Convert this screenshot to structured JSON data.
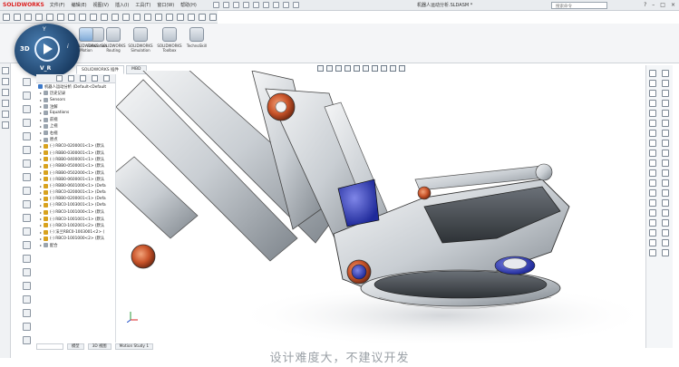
{
  "app": {
    "logo": "SOLIDWORKS",
    "menu": [
      "文件(F)",
      "编辑(E)",
      "视图(V)",
      "插入(I)",
      "工具(T)",
      "窗口(W)",
      "帮助(H)"
    ],
    "document_title": "机器人运动分析.SLDASM *",
    "search_placeholder": "搜索命令",
    "window_controls": [
      "?",
      "–",
      "□",
      "×"
    ]
  },
  "overlay": {
    "label_3d": "3D",
    "label_vr": "V_R",
    "label_i": "i",
    "label_y": "Y"
  },
  "ribbon": {
    "buttons": [
      {
        "label": "Simulation",
        "icon": "simulation-icon"
      },
      {
        "label": "SOLIDWORKS Motion",
        "icon": "motion-icon"
      },
      {
        "label": "SOLIDWORKS Routing",
        "icon": "routing-icon"
      },
      {
        "label": "SOLIDWORKS Simulation",
        "icon": "simulation-icon"
      },
      {
        "label": "SOLIDWORKS Toolbox",
        "icon": "toolbox-icon"
      },
      {
        "label": "TechnoSkill",
        "icon": "techno-icon"
      }
    ]
  },
  "tabs": {
    "items": [
      {
        "label": "SOLIDWORKS 插件",
        "active": true
      },
      {
        "label": "MBD",
        "active": false
      }
    ]
  },
  "tree": {
    "root": "机器人运动分析 (Default<Default",
    "items": [
      {
        "label": "历史记录",
        "icon": "gray"
      },
      {
        "label": "Sensors",
        "icon": "gray"
      },
      {
        "label": "注解",
        "icon": "gray"
      },
      {
        "label": "Equations",
        "icon": "gray"
      },
      {
        "label": "前视",
        "icon": "gray"
      },
      {
        "label": "上视",
        "icon": "gray"
      },
      {
        "label": "右视",
        "icon": "gray"
      },
      {
        "label": "原点",
        "icon": "gray"
      },
      {
        "label": "(-) RBC0-0200001<1> (默认",
        "icon": "gold"
      },
      {
        "label": "(-) RBB0-0300001<1> (默认",
        "icon": "gold"
      },
      {
        "label": "(-) RBB0-0400001<1> (默认",
        "icon": "gold"
      },
      {
        "label": "(-) RBB0-0500001<1> (默认",
        "icon": "gold"
      },
      {
        "label": "(-) RBB0-0502000<1> (默认",
        "icon": "gold"
      },
      {
        "label": "(-) RBB0-0600001<1> (默认",
        "icon": "gold"
      },
      {
        "label": "(-) RBB0-0601000<1> (Defa",
        "icon": "gold"
      },
      {
        "label": "(-) RBC0-0200001<1> (Defa",
        "icon": "gold"
      },
      {
        "label": "(-) RBB0-0200001<1> (Defa",
        "icon": "gold"
      },
      {
        "label": "(-) RBC0-1003001<1> (Defa",
        "icon": "gold"
      },
      {
        "label": "(-) RBC0-1001000<1> (默认",
        "icon": "gold"
      },
      {
        "label": "(-) RBC0-1001001<1> (默认",
        "icon": "gold"
      },
      {
        "label": "(-) RBC0-1002001<2> (默认",
        "icon": "gold"
      },
      {
        "label": "(-) 法兰RBC0-1003001<2> (",
        "icon": "gold"
      },
      {
        "label": "(-) RBC0-1001000<2> (默认",
        "icon": "gold"
      },
      {
        "label": "配合",
        "icon": "gray"
      }
    ]
  },
  "status": {
    "tabs": [
      "模型",
      "3D 视图",
      "Motion Study 1"
    ]
  },
  "subtitle": "设计难度大，不建议开发"
}
